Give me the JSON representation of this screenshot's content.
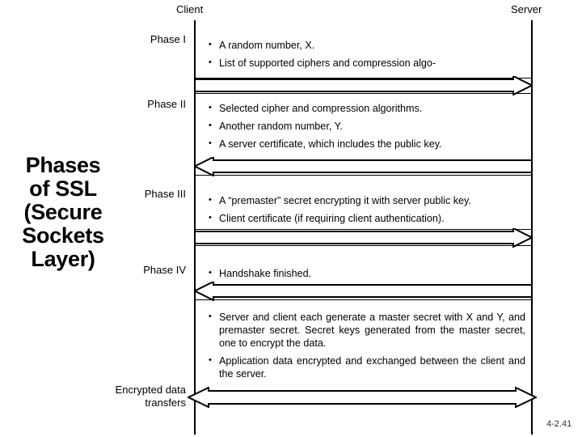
{
  "slide": {
    "title": "Phases\nof SSL\n(Secure\nSockets\nLayer)",
    "page_number": "4-2.41"
  },
  "diagram": {
    "type": "sequence-diagram",
    "columns": [
      {
        "id": "client",
        "label": "Client"
      },
      {
        "id": "server",
        "label": "Server"
      }
    ],
    "phases": [
      {
        "id": "phase-1",
        "label": "Phase I",
        "messages": [
          "A random number, X.",
          "List of supported ciphers and compression algo-"
        ],
        "arrow": {
          "direction": "right",
          "from": "client",
          "to": "server"
        }
      },
      {
        "id": "phase-2",
        "label": "Phase II",
        "messages": [
          "Selected cipher and compression algorithms.",
          "Another random number, Y.",
          "A server certificate, which includes the public key."
        ],
        "arrow": {
          "direction": "left",
          "from": "server",
          "to": "client"
        }
      },
      {
        "id": "phase-3",
        "label": "Phase III",
        "messages": [
          "A “premaster” secret encrypting it with server public key.",
          "Client certificate (if requiring client authentication)."
        ],
        "arrow": {
          "direction": "right",
          "from": "client",
          "to": "server"
        }
      },
      {
        "id": "phase-4",
        "label": "Phase IV",
        "messages": [
          "Handshake finished."
        ],
        "arrow": {
          "direction": "left",
          "from": "server",
          "to": "client"
        }
      },
      {
        "id": "encrypted-data",
        "label": "Encrypted data\ntransfers",
        "messages": [
          "Server and client each generate a master secret with X and Y, and premaster secret. Secret keys generated from the master secret, one to encrypt the data.",
          "Application data encrypted and exchanged between the client and the server."
        ],
        "arrow": {
          "direction": "both",
          "from": "client",
          "to": "server"
        }
      }
    ]
  },
  "colors": {
    "stroke": "#000000",
    "background": "#ffffff",
    "text": "#000000"
  }
}
